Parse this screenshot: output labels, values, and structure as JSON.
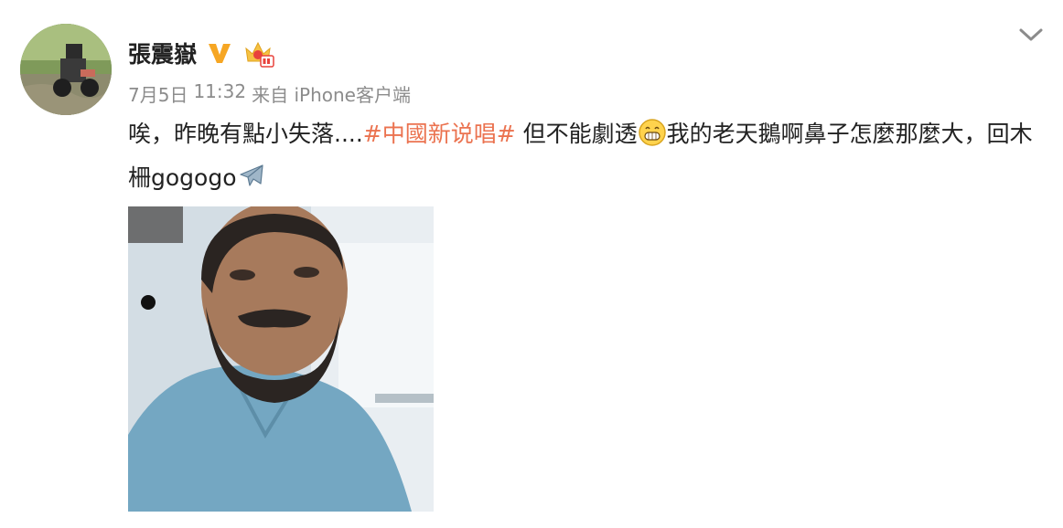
{
  "post": {
    "author_name": "張震嶽",
    "verified_icon": "verified-v-badge-icon",
    "member_icon": "crown-member-icon",
    "date": "7月5日",
    "time": "11:32",
    "source": "来自 iPhone客户端",
    "text_part1": "唉，昨晚有點小失落....",
    "hashtag": "#中國新说唱#",
    "text_part2": " 但不能劇透",
    "emoji_1": "grinning-face-icon",
    "text_part3": "我的老天鵝啊鼻子怎麼那麼大，回木柵gogogo",
    "emoji_2": "airplane-icon",
    "image_alt": "selfie-photo",
    "menu_icon": "chevron-down-icon"
  },
  "colors": {
    "hashtag": "#eb7350",
    "meta_text": "#8c8c8c",
    "badge_orange": "#f6a623",
    "crown_red": "#e8423c"
  }
}
